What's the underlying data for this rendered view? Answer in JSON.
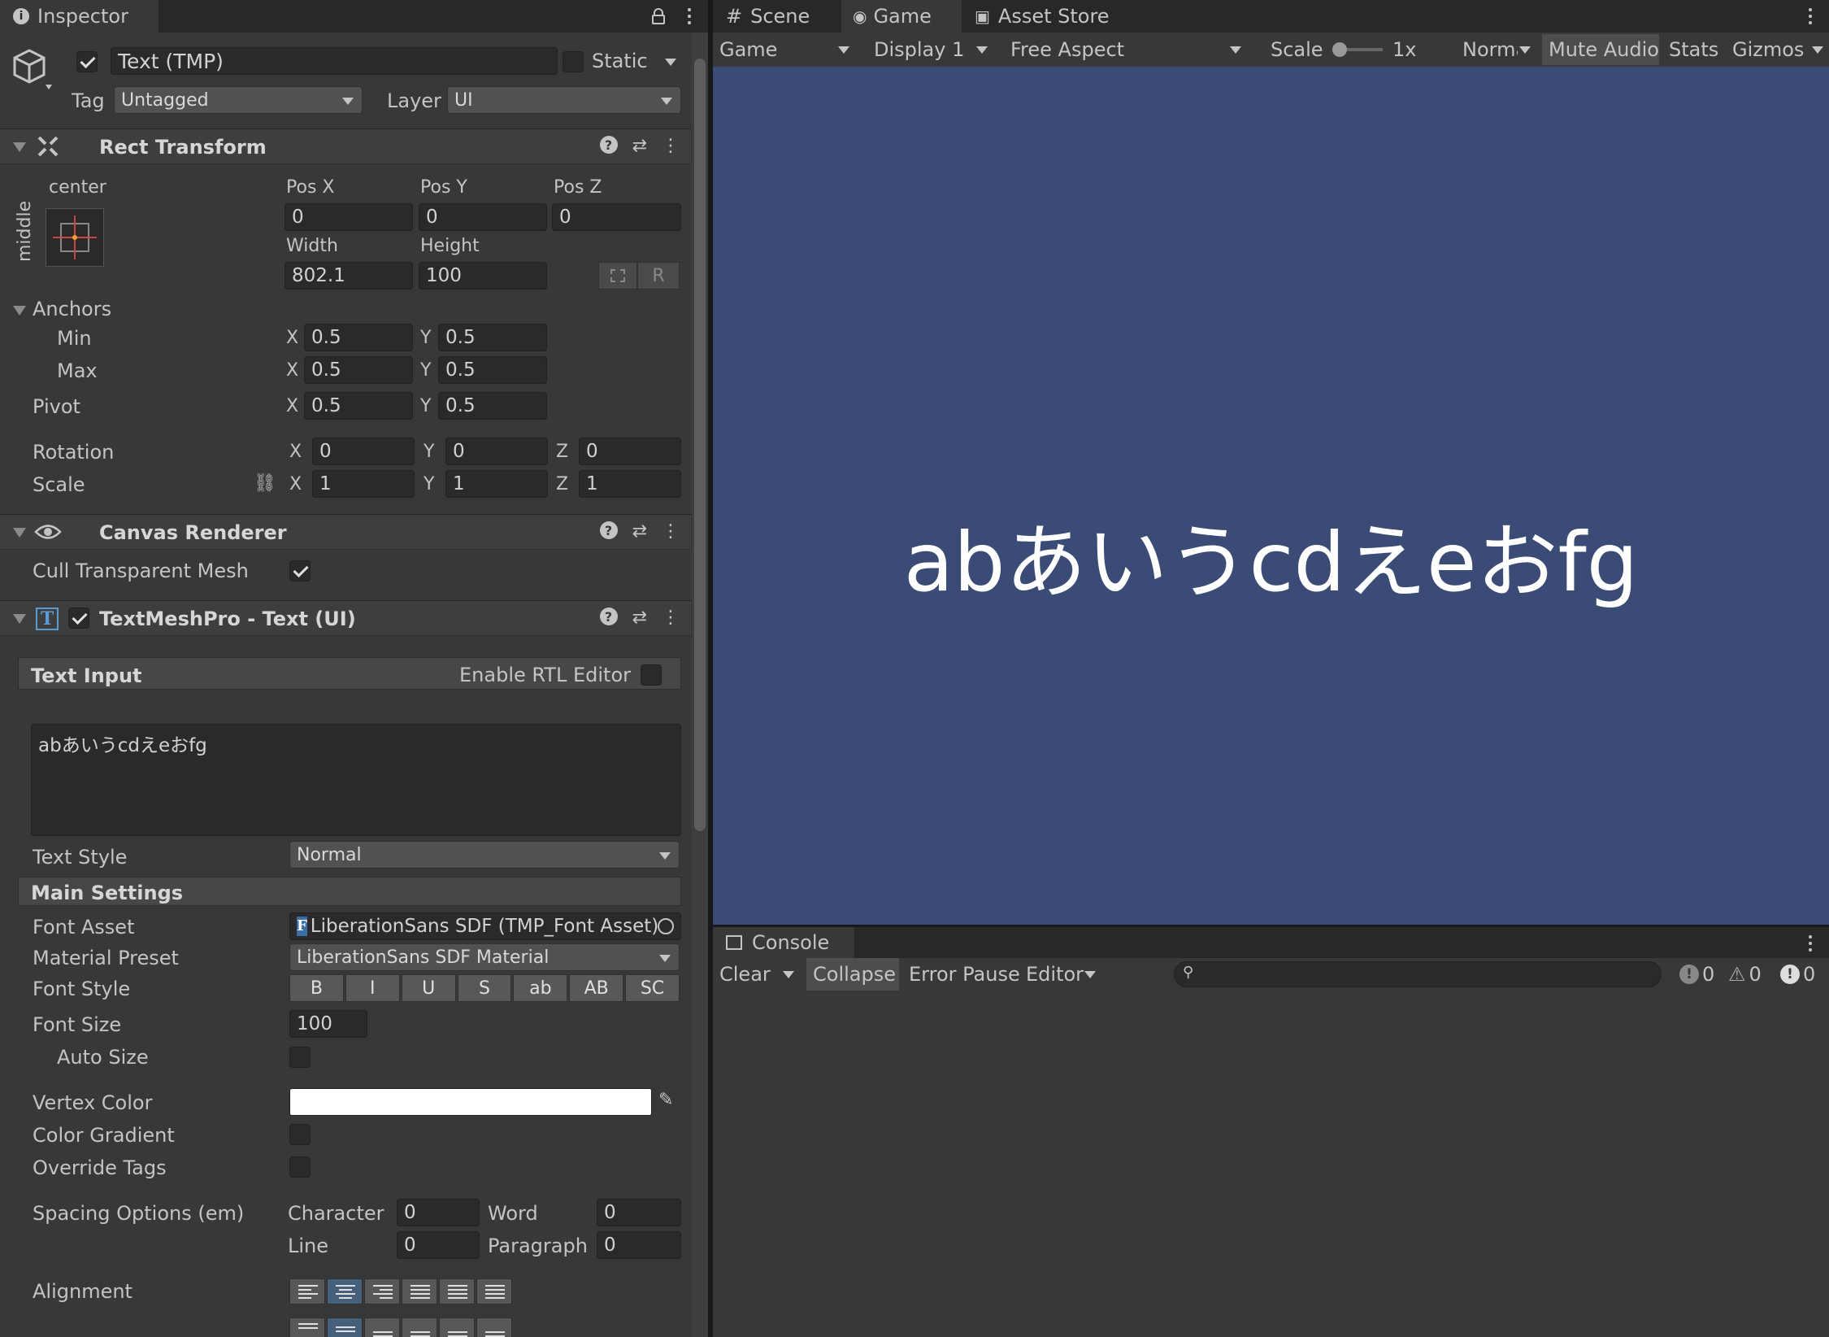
{
  "inspector": {
    "tab_label": "Inspector",
    "object": {
      "name": "Text (TMP)",
      "static_label": "Static",
      "tag_label": "Tag",
      "tag_value": "Untagged",
      "layer_label": "Layer",
      "layer_value": "UI"
    },
    "rect_transform": {
      "title": "Rect Transform",
      "anchor_h": "center",
      "anchor_v": "middle",
      "pos_x_label": "Pos X",
      "pos_y_label": "Pos Y",
      "pos_z_label": "Pos Z",
      "pos_x": "0",
      "pos_y": "0",
      "pos_z": "0",
      "width_label": "Width",
      "height_label": "Height",
      "width": "802.1",
      "height": "100",
      "r_button": "R",
      "anchors_label": "Anchors",
      "min_label": "Min",
      "max_label": "Max",
      "pivot_label": "Pivot",
      "x_label": "X",
      "y_label": "Y",
      "z_label": "Z",
      "min_x": "0.5",
      "min_y": "0.5",
      "max_x": "0.5",
      "max_y": "0.5",
      "pivot_x": "0.5",
      "pivot_y": "0.5",
      "rotation_label": "Rotation",
      "rot_x": "0",
      "rot_y": "0",
      "rot_z": "0",
      "scale_label": "Scale",
      "scale_x": "1",
      "scale_y": "1",
      "scale_z": "1"
    },
    "canvas_renderer": {
      "title": "Canvas Renderer",
      "cull_label": "Cull Transparent Mesh",
      "cull_checked": true
    },
    "tmp": {
      "title": "TextMeshPro - Text (UI)",
      "icon_letter": "T",
      "text_input_label": "Text Input",
      "rtl_label": "Enable RTL Editor",
      "text_value": "abあいうcdえeおfg",
      "text_style_label": "Text Style",
      "text_style_value": "Normal",
      "main_settings_label": "Main Settings",
      "font_asset_label": "Font Asset",
      "font_asset_value": "LiberationSans SDF (TMP_Font Asset)",
      "font_asset_icon": "F",
      "material_label": "Material Preset",
      "material_value": "LiberationSans SDF Material",
      "font_style_label": "Font Style",
      "font_style_buttons": [
        "B",
        "I",
        "U",
        "S",
        "ab",
        "AB",
        "SC"
      ],
      "font_size_label": "Font Size",
      "font_size_value": "100",
      "auto_size_label": "Auto Size",
      "vertex_color_label": "Vertex Color",
      "vertex_color": "#ffffff",
      "color_gradient_label": "Color Gradient",
      "override_tags_label": "Override Tags",
      "spacing_label": "Spacing Options (em)",
      "character_label": "Character",
      "character_value": "0",
      "word_label": "Word",
      "word_value": "0",
      "line_label": "Line",
      "line_value": "0",
      "paragraph_label": "Paragraph",
      "paragraph_value": "0",
      "alignment_label": "Alignment"
    }
  },
  "game_view": {
    "tabs": [
      "Scene",
      "Game",
      "Asset Store"
    ],
    "game_dropdown": "Game",
    "display_dropdown": "Display 1",
    "aspect_dropdown": "Free Aspect",
    "scale_label": "Scale",
    "scale_value": "1x",
    "normal_dropdown": "Normal",
    "mute_audio": "Mute Audio",
    "stats": "Stats",
    "gizmos": "Gizmos",
    "rendered_text": "abあいうcdえeおfg",
    "background_color": "#3a4b76"
  },
  "console": {
    "tab_label": "Console",
    "clear": "Clear",
    "collapse": "Collapse",
    "error_pause": "Error Pause",
    "editor": "Editor",
    "search_placeholder": "",
    "info_count": "0",
    "warn_count": "0",
    "error_count": "0"
  }
}
